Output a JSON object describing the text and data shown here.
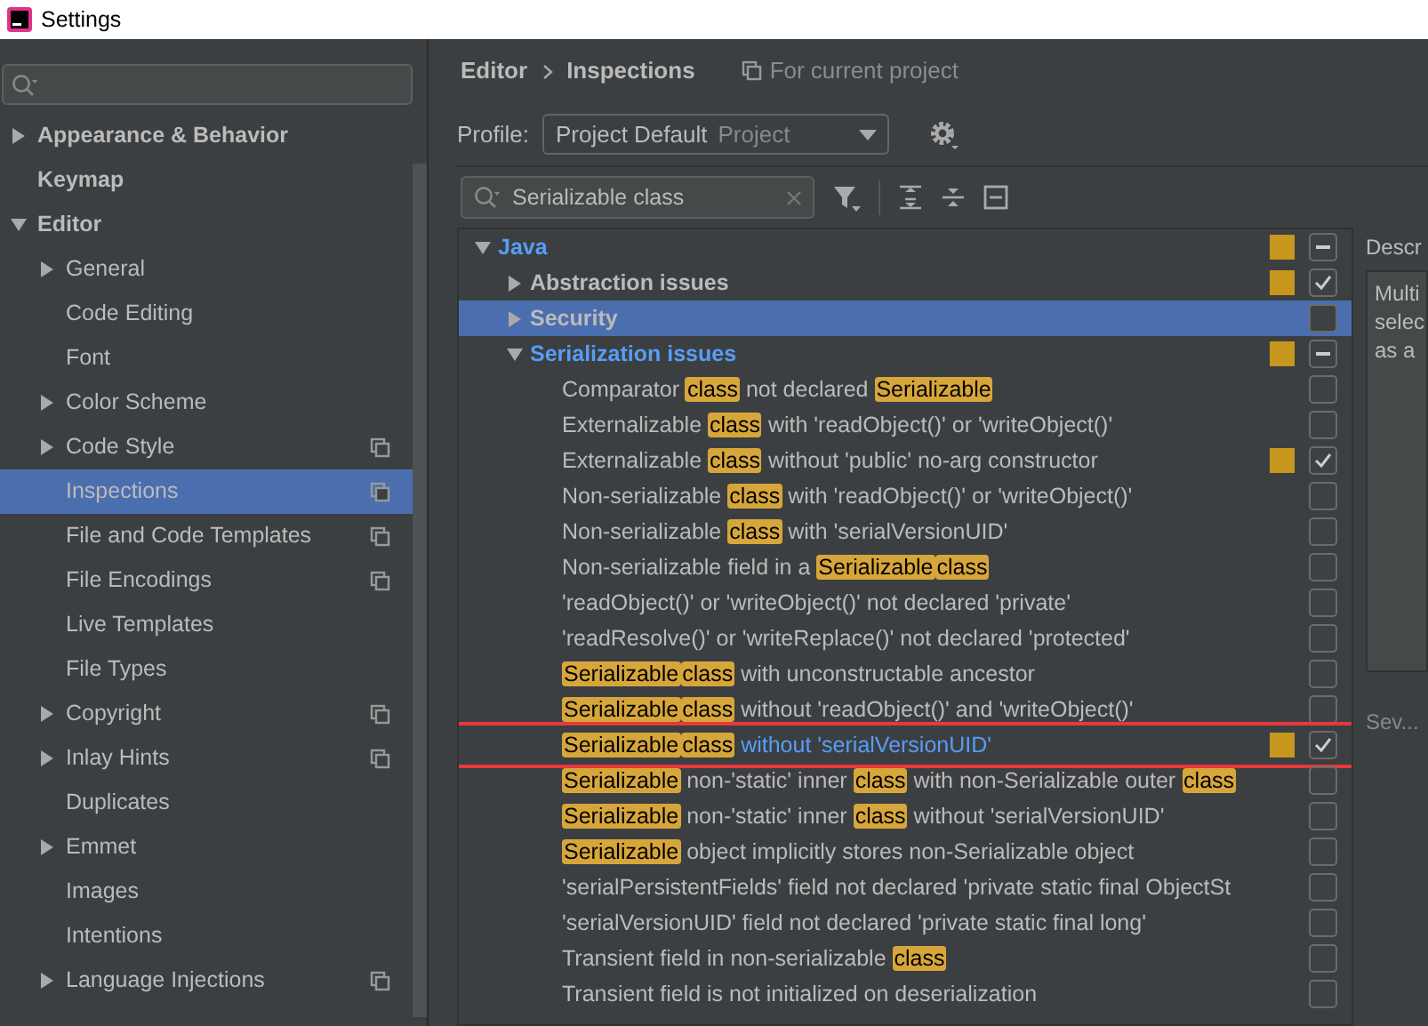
{
  "window": {
    "title": "Settings"
  },
  "sidebar": {
    "items": [
      {
        "label": "Appearance & Behavior",
        "expanded": false,
        "selected": false,
        "project_icon": false
      },
      {
        "label": "Keymap",
        "selected": false,
        "project_icon": false
      },
      {
        "label": "Editor",
        "expanded": true,
        "selected": false,
        "project_icon": false,
        "children": [
          {
            "label": "General",
            "expanded": false,
            "selected": false,
            "project_icon": false
          },
          {
            "label": "Code Editing",
            "selected": false,
            "project_icon": false
          },
          {
            "label": "Font",
            "selected": false,
            "project_icon": false
          },
          {
            "label": "Color Scheme",
            "expanded": false,
            "selected": false,
            "project_icon": false
          },
          {
            "label": "Code Style",
            "expanded": false,
            "selected": false,
            "project_icon": true
          },
          {
            "label": "Inspections",
            "selected": true,
            "project_icon": true
          },
          {
            "label": "File and Code Templates",
            "selected": false,
            "project_icon": true
          },
          {
            "label": "File Encodings",
            "selected": false,
            "project_icon": true
          },
          {
            "label": "Live Templates",
            "selected": false,
            "project_icon": false
          },
          {
            "label": "File Types",
            "selected": false,
            "project_icon": false
          },
          {
            "label": "Copyright",
            "expanded": false,
            "selected": false,
            "project_icon": true
          },
          {
            "label": "Inlay Hints",
            "expanded": false,
            "selected": false,
            "project_icon": true
          },
          {
            "label": "Duplicates",
            "selected": false,
            "project_icon": false
          },
          {
            "label": "Emmet",
            "expanded": false,
            "selected": false,
            "project_icon": false
          },
          {
            "label": "Images",
            "selected": false,
            "project_icon": false
          },
          {
            "label": "Intentions",
            "selected": false,
            "project_icon": false
          },
          {
            "label": "Language Injections",
            "expanded": false,
            "selected": false,
            "project_icon": true
          }
        ]
      }
    ]
  },
  "breadcrumb": [
    "Editor",
    "Inspections"
  ],
  "scope_note": "For current project",
  "profile": {
    "label": "Profile:",
    "value": "Project Default",
    "scope": "Project"
  },
  "filter": {
    "value": "Serializable class"
  },
  "tree": [
    {
      "segments": [
        {
          "text": "Java",
          "match": false
        }
      ],
      "bold": true,
      "modified": true,
      "expanded": true,
      "selected": false,
      "severity_mark": true,
      "partial": true,
      "children": [
        {
          "segments": [
            {
              "text": "Abstraction issues",
              "match": false
            }
          ],
          "bold": true,
          "modified": false,
          "expanded": false,
          "selected": false,
          "severity_mark": true,
          "checked": true,
          "partial": false
        },
        {
          "segments": [
            {
              "text": "Security",
              "match": false
            }
          ],
          "bold": true,
          "modified": false,
          "expanded": false,
          "selected": true,
          "severity_mark": false,
          "checked": false,
          "partial": false
        },
        {
          "segments": [
            {
              "text": "Serialization issues",
              "match": false
            }
          ],
          "bold": true,
          "modified": true,
          "expanded": true,
          "selected": false,
          "severity_mark": true,
          "partial": true,
          "children": [
            {
              "segments": [
                {
                  "text": "Comparator ",
                  "match": false
                },
                {
                  "text": "class",
                  "match": true
                },
                {
                  "text": " not declared ",
                  "match": false
                },
                {
                  "text": "Serializable",
                  "match": true
                }
              ],
              "modified": false,
              "selected": false,
              "severity_mark": false,
              "checked": false,
              "highlighted": false
            },
            {
              "segments": [
                {
                  "text": "Externalizable ",
                  "match": false
                },
                {
                  "text": "class",
                  "match": true
                },
                {
                  "text": " with 'readObject()' or 'writeObject()'",
                  "match": false
                }
              ],
              "modified": false,
              "selected": false,
              "severity_mark": false,
              "checked": false,
              "highlighted": false
            },
            {
              "segments": [
                {
                  "text": "Externalizable ",
                  "match": false
                },
                {
                  "text": "class",
                  "match": true
                },
                {
                  "text": " without 'public' no-arg constructor",
                  "match": false
                }
              ],
              "modified": false,
              "selected": false,
              "severity_mark": true,
              "checked": true,
              "highlighted": false
            },
            {
              "segments": [
                {
                  "text": "Non-serializable ",
                  "match": false
                },
                {
                  "text": "class",
                  "match": true
                },
                {
                  "text": " with 'readObject()' or 'writeObject()'",
                  "match": false
                }
              ],
              "modified": false,
              "selected": false,
              "severity_mark": false,
              "checked": false,
              "highlighted": false
            },
            {
              "segments": [
                {
                  "text": "Non-serializable ",
                  "match": false
                },
                {
                  "text": "class",
                  "match": true
                },
                {
                  "text": " with 'serialVersionUID'",
                  "match": false
                }
              ],
              "modified": false,
              "selected": false,
              "severity_mark": false,
              "checked": false,
              "highlighted": false
            },
            {
              "segments": [
                {
                  "text": "Non-serializable field in a ",
                  "match": false
                },
                {
                  "text": "Serializable",
                  "match": true
                },
                {
                  "text": "class",
                  "match": true
                }
              ],
              "modified": false,
              "selected": false,
              "severity_mark": false,
              "checked": false,
              "highlighted": false
            },
            {
              "segments": [
                {
                  "text": "'readObject()' or 'writeObject()' not declared 'private'",
                  "match": false
                }
              ],
              "modified": false,
              "selected": false,
              "severity_mark": false,
              "checked": false,
              "highlighted": false
            },
            {
              "segments": [
                {
                  "text": "'readResolve()' or 'writeReplace()' not declared 'protected'",
                  "match": false
                }
              ],
              "modified": false,
              "selected": false,
              "severity_mark": false,
              "checked": false,
              "highlighted": false
            },
            {
              "segments": [
                {
                  "text": "Serializable",
                  "match": true
                },
                {
                  "text": "class",
                  "match": true
                },
                {
                  "text": " with unconstructable ancestor",
                  "match": false
                }
              ],
              "modified": false,
              "selected": false,
              "severity_mark": false,
              "checked": false,
              "highlighted": false
            },
            {
              "segments": [
                {
                  "text": "Serializable",
                  "match": true
                },
                {
                  "text": "class",
                  "match": true
                },
                {
                  "text": " without 'readObject()' and 'writeObject()'",
                  "match": false
                }
              ],
              "modified": false,
              "selected": false,
              "severity_mark": false,
              "checked": false,
              "highlighted": false
            },
            {
              "segments": [
                {
                  "text": "Serializable",
                  "match": true
                },
                {
                  "text": "class",
                  "match": true
                },
                {
                  "text": " without 'serialVersionUID'",
                  "match": false
                }
              ],
              "modified": true,
              "selected": false,
              "severity_mark": true,
              "checked": true,
              "highlighted": true
            },
            {
              "segments": [
                {
                  "text": "Serializable",
                  "match": true
                },
                {
                  "text": " non-'static' inner ",
                  "match": false
                },
                {
                  "text": "class",
                  "match": true
                },
                {
                  "text": " with non-Serializable outer ",
                  "match": false
                },
                {
                  "text": "class",
                  "match": true
                }
              ],
              "modified": false,
              "selected": false,
              "severity_mark": false,
              "checked": false,
              "highlighted": false
            },
            {
              "segments": [
                {
                  "text": "Serializable",
                  "match": true
                },
                {
                  "text": " non-'static' inner ",
                  "match": false
                },
                {
                  "text": "class",
                  "match": true
                },
                {
                  "text": " without 'serialVersionUID'",
                  "match": false
                }
              ],
              "modified": false,
              "selected": false,
              "severity_mark": false,
              "checked": false,
              "highlighted": false
            },
            {
              "segments": [
                {
                  "text": "Serializable",
                  "match": true
                },
                {
                  "text": " object implicitly stores non-Serializable object",
                  "match": false
                }
              ],
              "modified": false,
              "selected": false,
              "severity_mark": false,
              "checked": false,
              "highlighted": false
            },
            {
              "segments": [
                {
                  "text": "'serialPersistentFields' field not declared 'private static final ObjectSt",
                  "match": false
                }
              ],
              "modified": false,
              "selected": false,
              "severity_mark": false,
              "checked": false,
              "highlighted": false
            },
            {
              "segments": [
                {
                  "text": "'serialVersionUID' field not declared 'private static final long'",
                  "match": false
                }
              ],
              "modified": false,
              "selected": false,
              "severity_mark": false,
              "checked": false,
              "highlighted": false
            },
            {
              "segments": [
                {
                  "text": "Transient field in non-serializable ",
                  "match": false
                },
                {
                  "text": "class",
                  "match": true
                }
              ],
              "modified": false,
              "selected": false,
              "severity_mark": false,
              "checked": false,
              "highlighted": false
            },
            {
              "segments": [
                {
                  "text": "Transient field is not initialized on deserialization",
                  "match": false
                }
              ],
              "modified": false,
              "selected": false,
              "severity_mark": false,
              "checked": false,
              "highlighted": false
            }
          ]
        }
      ]
    }
  ],
  "description": {
    "heading": "Descr",
    "lines": [
      "Multi",
      "selec",
      "as a"
    ],
    "severity_label": "Sev..."
  }
}
